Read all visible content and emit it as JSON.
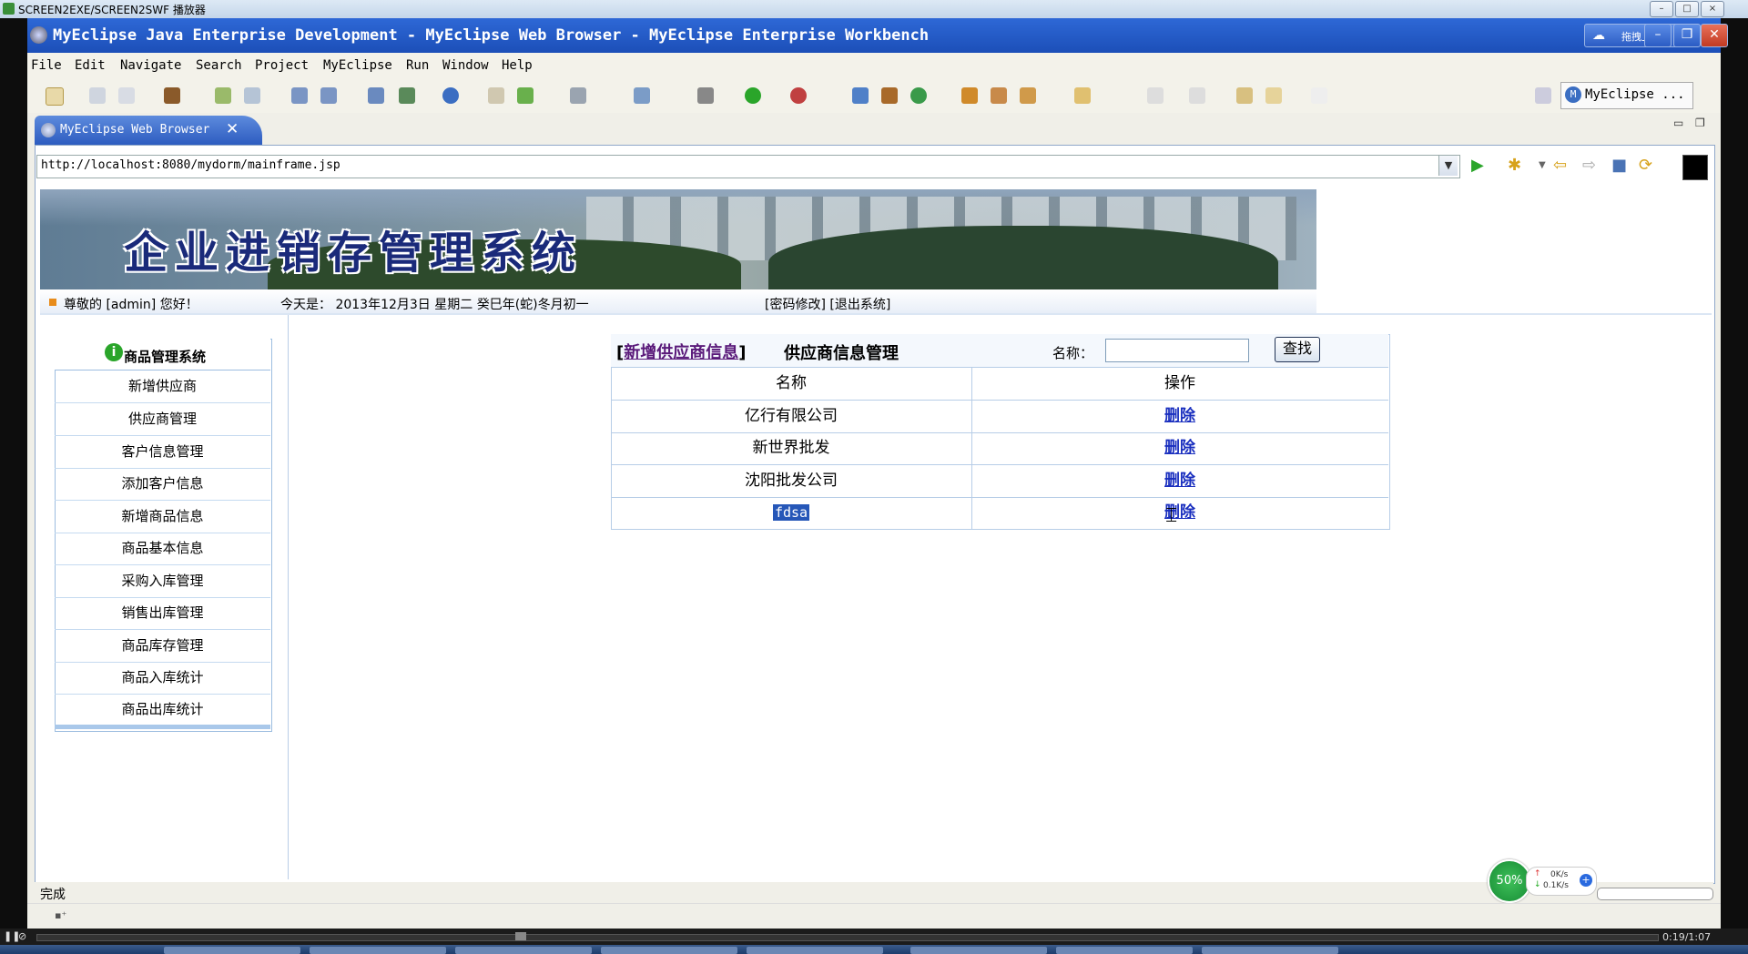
{
  "player": {
    "title": "SCREEN2EXE/SCREEN2SWF 播放器",
    "time": "0:19/1:07"
  },
  "ide": {
    "title": "MyEclipse Java Enterprise Development - MyEclipse Web Browser - MyEclipse Enterprise Workbench",
    "upload_label": "拖拽上传",
    "menu": [
      "File",
      "Edit",
      "Navigate",
      "Search",
      "Project",
      "MyEclipse",
      "Run",
      "Window",
      "Help"
    ],
    "perspective": "MyEclipse ...",
    "tab_label": "MyEclipse Web Browser",
    "status": "完成"
  },
  "browser": {
    "url": "http://localhost:8080/mydorm/mainframe.jsp"
  },
  "page": {
    "banner_title": "企业进销存管理系统",
    "welcome": "尊敬的 [admin] 您好！",
    "date": "今天是： 2013年12月3日 星期二 癸巳年(蛇)冬月初一",
    "links": "[密码修改] [退出系统]",
    "sidebar": {
      "title": "商品管理系统",
      "items": [
        "新增供应商",
        "供应商管理",
        "客户信息管理",
        "添加客户信息",
        "新增商品信息",
        "商品基本信息",
        "采购入库管理",
        "销售出库管理",
        "商品库存管理",
        "商品入库统计",
        "商品出库统计"
      ]
    },
    "supplier": {
      "add_link": "新增供应商信息",
      "title": "供应商信息管理",
      "name_label": "名称：",
      "search_value": "",
      "search_button": "查找",
      "col_name": "名称",
      "col_action": "操作",
      "rows": [
        {
          "name": "亿行有限公司",
          "action": "删除"
        },
        {
          "name": "新世界批发",
          "action": "删除"
        },
        {
          "name": "沈阳批发公司",
          "action": "删除"
        },
        {
          "name": "fdsa",
          "action": "删除"
        }
      ]
    }
  },
  "network": {
    "percent": "50%",
    "up": "0K/s",
    "down": "0.1K/s"
  }
}
